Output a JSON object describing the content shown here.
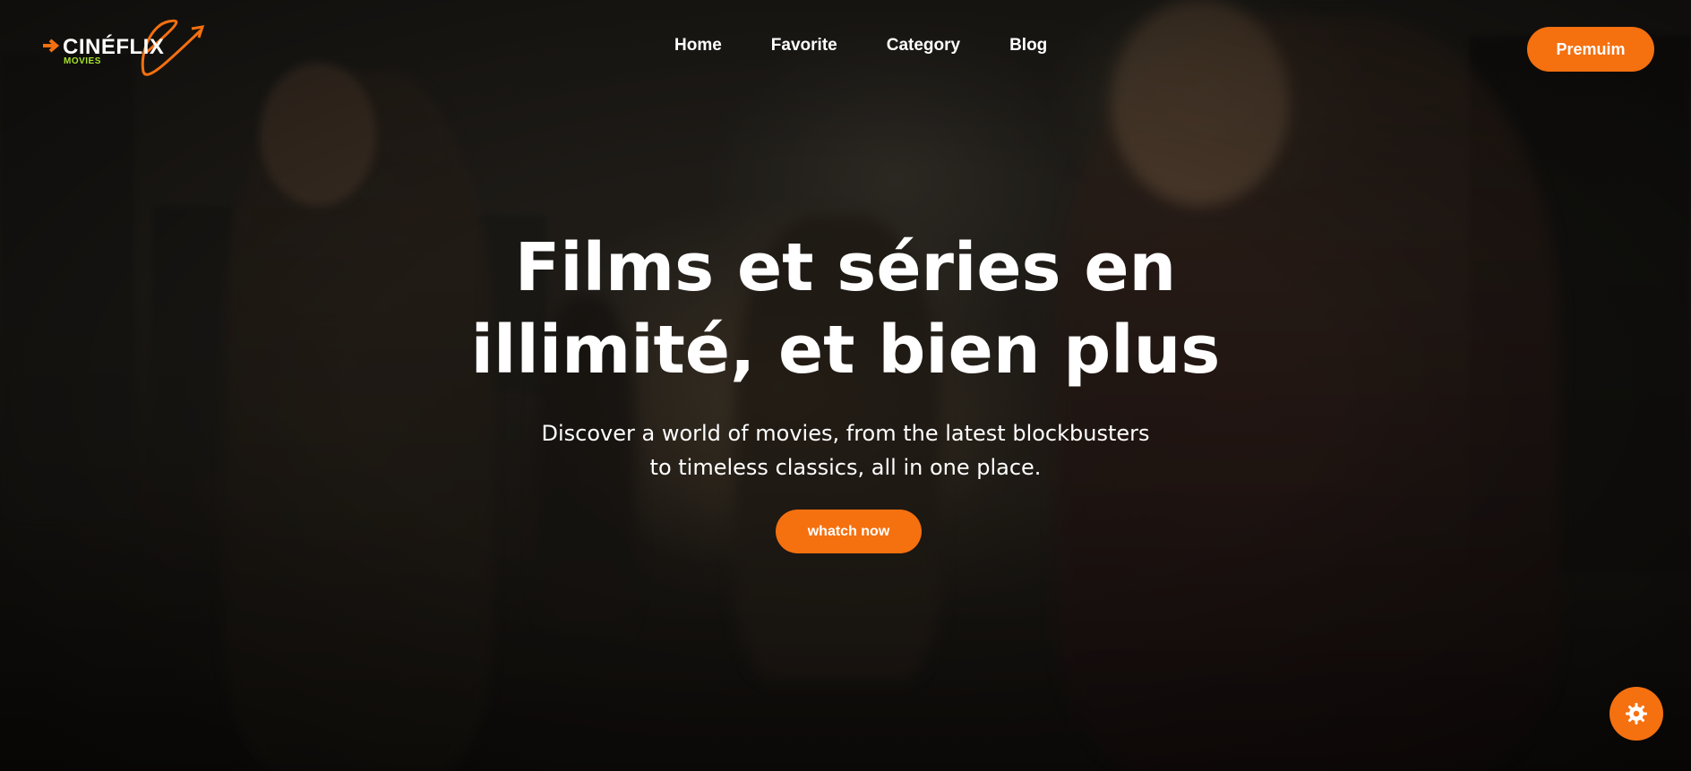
{
  "brand": {
    "name": "CINÉFLIX",
    "tagline": "MOVIES",
    "accent_color": "#f5700f",
    "tagline_color": "#a6e22e"
  },
  "nav": {
    "items": [
      {
        "label": "Home"
      },
      {
        "label": "Favorite"
      },
      {
        "label": "Category"
      },
      {
        "label": "Blog"
      }
    ]
  },
  "header": {
    "premium_label": "Premuim"
  },
  "hero": {
    "title_line1": "Films et séries en",
    "title_line2": "illimité, et bien plus",
    "subtitle_line1": "Discover a world of movies, from the latest blockbusters",
    "subtitle_line2": "to timeless classics, all in one place.",
    "cta_label": "whatch now"
  },
  "floating_button": {
    "icon": "settings-gear-icon"
  }
}
